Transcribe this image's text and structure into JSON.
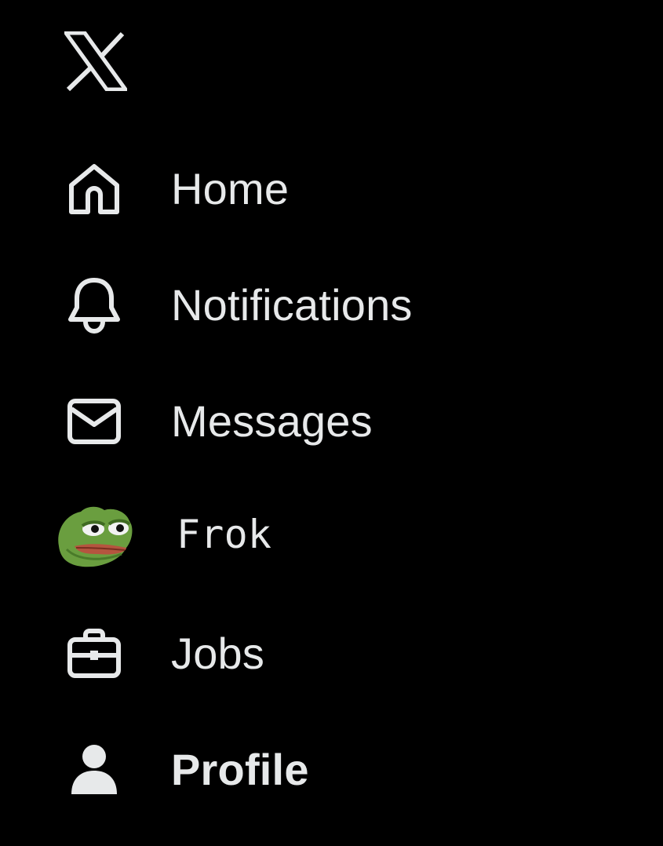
{
  "logo": {
    "icon": "x-logo-icon"
  },
  "nav": {
    "items": [
      {
        "label": "Home",
        "icon": "home-icon"
      },
      {
        "label": "Notifications",
        "icon": "bell-icon"
      },
      {
        "label": "Messages",
        "icon": "envelope-icon"
      },
      {
        "label": "Frok",
        "icon": "frog-avatar-icon"
      },
      {
        "label": "Jobs",
        "icon": "briefcase-icon"
      },
      {
        "label": "Profile",
        "icon": "person-icon"
      }
    ]
  },
  "colors": {
    "background": "#000000",
    "text": "#e7e9ea",
    "frog_green": "#6a9e3f",
    "frog_lip": "#b5553f"
  }
}
